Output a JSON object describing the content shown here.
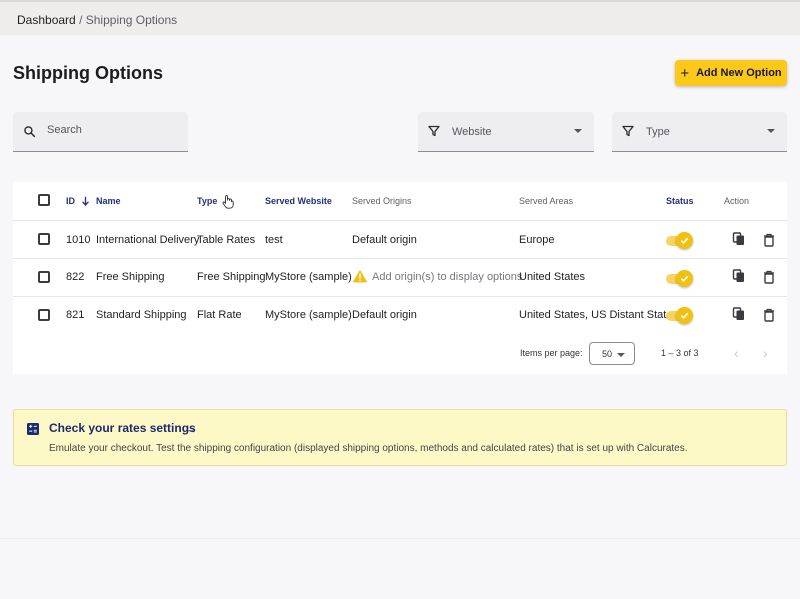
{
  "breadcrumb": {
    "root": "Dashboard",
    "separator": "/",
    "current": "Shipping Options"
  },
  "page": {
    "title": "Shipping Options",
    "add_button_label": "Add New Option",
    "add_button_symbol": "+"
  },
  "filters": {
    "search_label": "Search",
    "website_label": "Website",
    "type_label": "Type"
  },
  "table": {
    "headers": {
      "id": "ID",
      "name": "Name",
      "type": "Type",
      "served_website": "Served Website",
      "served_origins": "Served Origins",
      "served_areas": "Served Areas",
      "status": "Status",
      "action": "Action"
    },
    "rows": [
      {
        "id": "1010",
        "name": "International Delivery",
        "type": "Table Rates",
        "website": "test",
        "origins": "Default origin",
        "areas": "Europe",
        "status": "on"
      },
      {
        "id": "822",
        "name": "Free Shipping",
        "type": "Free Shipping",
        "website": "MyStore (sample)",
        "origins": "Add origin(s) to display options",
        "areas": "United States",
        "status": "on"
      },
      {
        "id": "821",
        "name": "Standard Shipping",
        "type": "Flat Rate",
        "website": "MyStore (sample)",
        "origins": "Default origin",
        "areas": "United States, US Distant Stat...",
        "status": "on"
      }
    ]
  },
  "pagination": {
    "items_per_page_label": "Items per page:",
    "page_size": "50",
    "range": "1 – 3 of 3"
  },
  "banner": {
    "title": "Check your rates settings",
    "arrow": "→",
    "text": "Emulate your checkout. Test the shipping configuration (displayed shipping options, methods and calculated rates) that is set up with Calcurates."
  },
  "colors": {
    "accent": "#fcc81a",
    "active_header": "#24307a",
    "banner_bg": "#fdf9c6"
  }
}
